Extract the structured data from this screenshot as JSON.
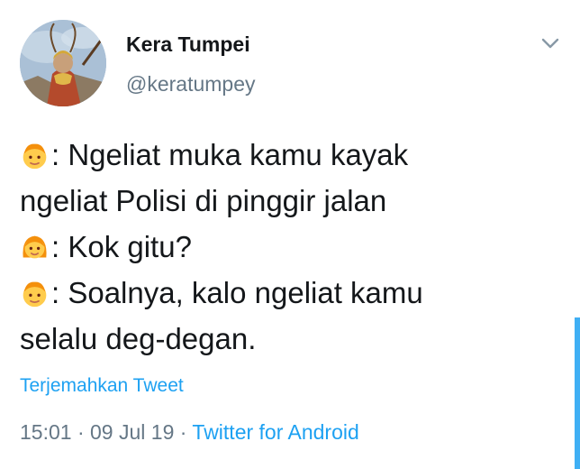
{
  "tweet": {
    "display_name": "Kera Tumpei",
    "handle": "@keratumpey",
    "menu_icon": "chevron-down-icon",
    "lines": [
      {
        "emoji": "boy-emoji",
        "text": ": Ngeliat muka kamu kayak"
      },
      {
        "emoji": null,
        "text": "ngeliat Polisi di pinggir jalan"
      },
      {
        "emoji": "girl-emoji",
        "text": ": Kok gitu?"
      },
      {
        "emoji": "boy-emoji",
        "text": ": Soalnya, kalo ngeliat kamu"
      },
      {
        "emoji": null,
        "text": "selalu deg-degan."
      }
    ],
    "translate_label": "Terjemahkan Tweet",
    "time": "15:01",
    "separator": "·",
    "date": "09 Jul 19",
    "source": "Twitter for Android"
  },
  "colors": {
    "text": "#14171a",
    "muted": "#657786",
    "link": "#1da1f2",
    "background": "#ffffff"
  }
}
